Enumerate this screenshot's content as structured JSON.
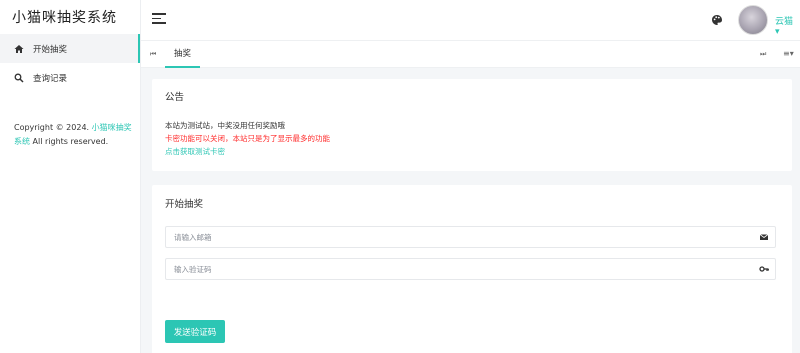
{
  "app": {
    "logo_text": "小猫咪抽奖系统"
  },
  "sidebar": {
    "items": [
      {
        "label": "开始抽奖",
        "icon": "home-icon",
        "active": true
      },
      {
        "label": "查询记录",
        "icon": "search-icon",
        "active": false
      }
    ],
    "copyright": {
      "prefix": "Copyright © 2024. ",
      "link": "小猫咪抽奖系统",
      "suffix": " All rights reserved."
    }
  },
  "header": {
    "theme_icon": "palette-icon",
    "username": "云猫"
  },
  "tabs": [
    {
      "label": "抽奖"
    }
  ],
  "notice": {
    "title": "公告",
    "line1": "本站为测试站，中奖没用任何奖励哦",
    "line2": "卡密功能可以关闭，本站只是为了显示最多的功能",
    "line3": "点击获取测试卡密"
  },
  "lottery": {
    "title": "开始抽奖",
    "email_placeholder": "请输入邮箱",
    "code_placeholder": "输入验证码",
    "send_button": "发送验证码"
  },
  "colors": {
    "accent": "#2cc6b4",
    "warning": "#ff2b2b"
  }
}
